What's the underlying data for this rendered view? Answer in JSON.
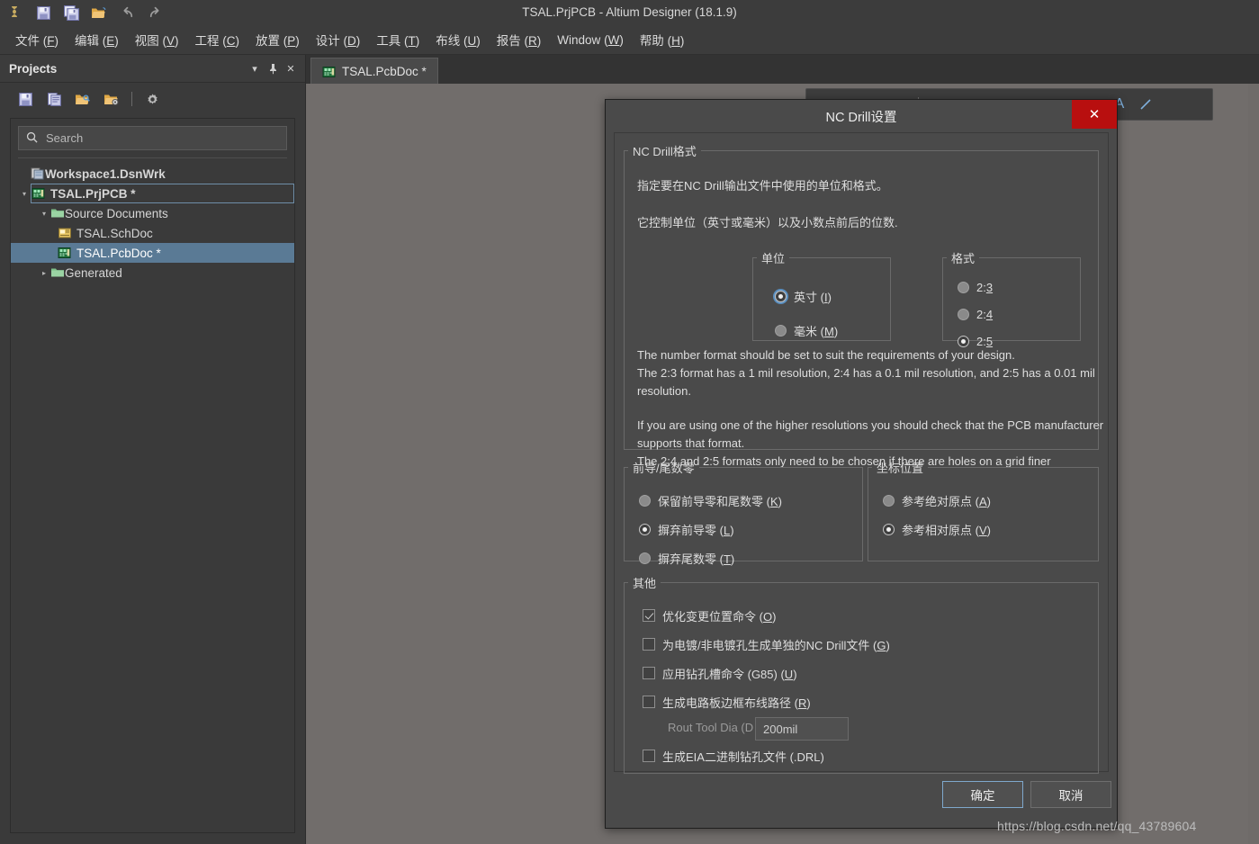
{
  "app": {
    "title": "TSAL.PrjPCB - Altium Designer (18.1.9)",
    "titlebar_icons": [
      "altium-logo-icon",
      "save-icon",
      "save-all-icon",
      "open-icon",
      "undo-icon",
      "redo-icon"
    ],
    "menu": [
      {
        "label": "文件",
        "accel": "F"
      },
      {
        "label": "编辑",
        "accel": "E"
      },
      {
        "label": "视图",
        "accel": "V"
      },
      {
        "label": "工程",
        "accel": "C"
      },
      {
        "label": "放置",
        "accel": "P"
      },
      {
        "label": "设计",
        "accel": "D"
      },
      {
        "label": "工具",
        "accel": "T"
      },
      {
        "label": "布线",
        "accel": "U"
      },
      {
        "label": "报告",
        "accel": "R"
      },
      {
        "label": "Window",
        "accel": "W"
      },
      {
        "label": "帮助",
        "accel": "H"
      }
    ]
  },
  "panel": {
    "title": "Projects",
    "header_buttons": [
      "chevron-down-icon",
      "pin-icon",
      "close-icon"
    ],
    "toolbar_icons": [
      "save-icon",
      "copy-icon",
      "open-project-icon",
      "project-options-icon",
      "gear-icon"
    ],
    "search": {
      "value": "",
      "placeholder": "Search"
    },
    "tree": [
      {
        "label": "Workspace1.DsnWrk",
        "indent": 0,
        "twisty": "",
        "icon": "workspace-icon",
        "bold": true,
        "state": "normal"
      },
      {
        "label": "TSAL.PrjPCB *",
        "indent": 1,
        "twisty": "▾",
        "icon": "pcb-project-icon",
        "bold": true,
        "state": "outlined"
      },
      {
        "label": "Source Documents",
        "indent": 2,
        "twisty": "▾",
        "icon": "folder-icon",
        "bold": false,
        "state": "normal"
      },
      {
        "label": "TSAL.SchDoc",
        "indent": 3,
        "twisty": "",
        "icon": "sch-doc-icon",
        "bold": false,
        "state": "normal"
      },
      {
        "label": "TSAL.PcbDoc *",
        "indent": 3,
        "twisty": "",
        "icon": "pcb-doc-icon",
        "bold": false,
        "state": "selected"
      },
      {
        "label": "Generated",
        "indent": 2,
        "twisty": "▸",
        "icon": "folder-icon",
        "bold": false,
        "state": "normal"
      }
    ]
  },
  "document_tab": {
    "label": "TSAL.PcbDoc *",
    "icon": "pcb-doc-icon"
  },
  "dialog": {
    "title": "NC Drill设置",
    "close_label": "✕",
    "format_group": {
      "legend": "NC Drill格式",
      "line1": "指定要在NC Drill输出文件中使用的单位和格式。",
      "line2": "它控制单位（英寸或毫米）以及小数点前后的位数.",
      "units_group": {
        "legend": "单位",
        "options": [
          {
            "label": "英寸",
            "accel": "I",
            "checked": true,
            "focused": true
          },
          {
            "label": "毫米",
            "accel": "M",
            "checked": false,
            "focused": false
          }
        ]
      },
      "digits_group": {
        "legend": "格式",
        "options": [
          {
            "label": "2:3",
            "accel": "3",
            "checked": false
          },
          {
            "label": "2:4",
            "accel": "4",
            "checked": false
          },
          {
            "label": "2:5",
            "accel": "5",
            "checked": true
          }
        ]
      },
      "help_paragraph_1": "The number format should be set to suit the requirements of your design.\nThe 2:3 format has a 1 mil resolution, 2:4 has a 0.1 mil resolution, and 2:5 has a 0.01 mil resolution.",
      "help_paragraph_2": "If you are using one of the higher resolutions you should check that the PCB manufacturer supports that format.\nThe 2:4 and 2:5 formats only need to be chosen if there are holes on a grid finer"
    },
    "zeros_group": {
      "legend": "前导/尾数零",
      "options": [
        {
          "label": "保留前导零和尾数零",
          "accel": "K",
          "checked": false
        },
        {
          "label": "摒弃前导零",
          "accel": "L",
          "checked": true
        },
        {
          "label": "摒弃尾数零",
          "accel": "T",
          "checked": false
        }
      ]
    },
    "coords_group": {
      "legend": "坐标位置",
      "options": [
        {
          "label": "参考绝对原点",
          "accel": "A",
          "checked": false
        },
        {
          "label": "参考相对原点",
          "accel": "V",
          "checked": true
        }
      ]
    },
    "other_group": {
      "legend": "其他",
      "checkboxes": [
        {
          "label": "优化变更位置命令",
          "suffix": "",
          "accel": "O",
          "checked": true
        },
        {
          "label": "为电镀/非电镀孔生成单独的NC Drill文件",
          "suffix": "",
          "accel": "G",
          "checked": false
        },
        {
          "label": "应用钻孔槽命令 (G85)",
          "suffix": "",
          "accel": "U",
          "checked": false
        },
        {
          "label": "生成电路板边框布线路径",
          "suffix": "",
          "accel": "R",
          "checked": false
        },
        {
          "label": "生成EIA二进制钻孔文件",
          "suffix": " (.DRL)",
          "accel": "",
          "checked": false
        }
      ],
      "rout_tool": {
        "label": "Rout Tool  Dia (D",
        "value": "200mil"
      }
    },
    "buttons": {
      "ok": "确定",
      "cancel": "取消"
    }
  },
  "watermark": "https://blog.csdn.net/qq_43789604"
}
